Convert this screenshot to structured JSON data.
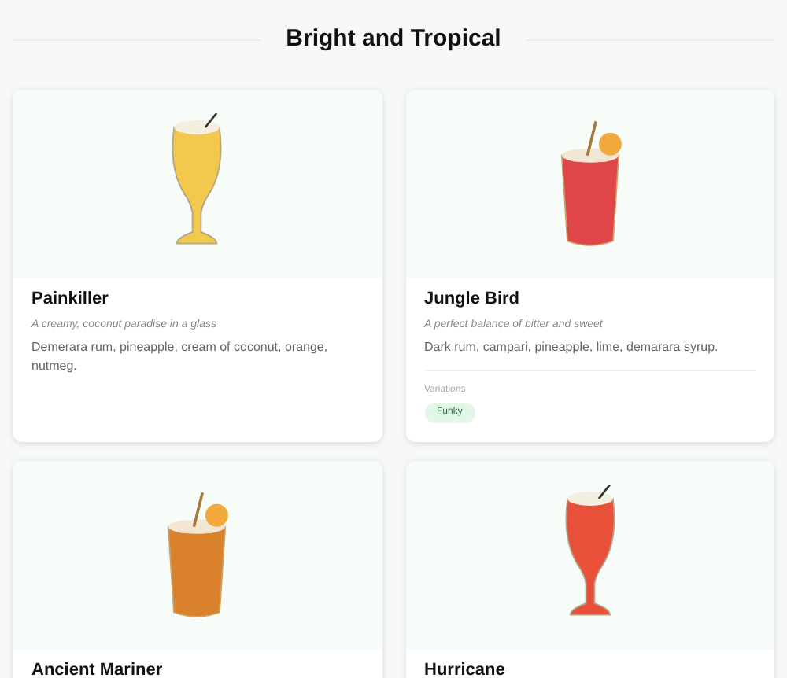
{
  "section": {
    "title": "Bright and Tropical"
  },
  "drinks": [
    {
      "name": "Painkiller",
      "kind": "hurricane",
      "color": "#f2c94c",
      "tagline": "A creamy, coconut paradise in a glass",
      "ingredients": "Demerara rum, pineapple, cream of coconut, orange, nutmeg."
    },
    {
      "name": "Jungle Bird",
      "kind": "rocks",
      "color": "#e0454a",
      "tagline": "A perfect balance of bitter and sweet",
      "ingredients": "Dark rum, campari, pineapple, lime, demarara syrup.",
      "variations": {
        "label": "Variations",
        "tags": [
          "Funky"
        ]
      }
    },
    {
      "name": "Ancient Mariner",
      "kind": "rocks",
      "color": "#d9822b"
    },
    {
      "name": "Hurricane",
      "kind": "hurricane",
      "color": "#e8503a"
    }
  ]
}
